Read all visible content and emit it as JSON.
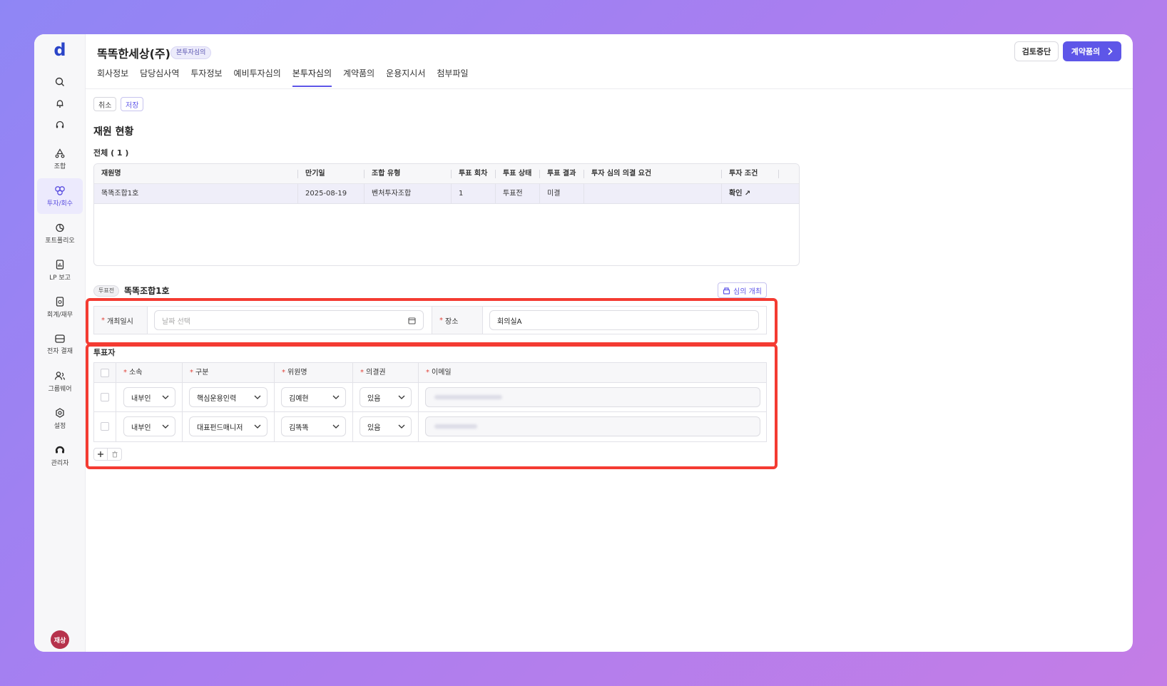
{
  "logo": "d",
  "sidebar": {
    "items": [
      {
        "label": "조합",
        "icon": "recycle-icon"
      },
      {
        "label": "투자/회수",
        "icon": "invest-icon",
        "active": true
      },
      {
        "label": "포트폴리오",
        "icon": "pie-chart-icon"
      },
      {
        "label": "LP 보고",
        "icon": "report-icon"
      },
      {
        "label": "회계/재무",
        "icon": "finance-doc-icon"
      },
      {
        "label": "전자 결재",
        "icon": "approval-icon"
      },
      {
        "label": "그룹웨어",
        "icon": "groupware-icon"
      },
      {
        "label": "설정",
        "icon": "settings-icon"
      },
      {
        "label": "관리자",
        "icon": "admin-icon"
      }
    ],
    "avatar": "재상"
  },
  "header": {
    "title": "똑똑한세상(주)",
    "badge": "본투자심의",
    "stop_label": "검토중단",
    "contract_label": "계약품의"
  },
  "tabs": [
    "회사정보",
    "담당심사역",
    "투자정보",
    "예비투자심의",
    "본투자심의",
    "계약품의",
    "운용지시서",
    "첨부파일"
  ],
  "active_tab": "본투자심의",
  "actions": {
    "cancel": "취소",
    "save": "저장"
  },
  "fund_section": {
    "title": "재원 현황",
    "total": "전체 ( 1 )",
    "columns": [
      "재원명",
      "만기일",
      "조합 유형",
      "투표 회차",
      "투표 상태",
      "투표 결과",
      "투자 심의 의결 요건",
      "투자 조건"
    ],
    "rows": [
      {
        "name": "똑똑조합1호",
        "due": "2025-08-19",
        "type": "벤처투자조합",
        "round": "1",
        "status": "투표전",
        "result": "미결",
        "requirement": "",
        "condition": "확인 ↗"
      }
    ]
  },
  "vote_section": {
    "badge": "투표전",
    "title": "똑똑조합1호",
    "open_button": "심의 개최",
    "date_label": "개최일시",
    "date_placeholder": "날짜 선택",
    "place_label": "장소",
    "place_value": "회의실A",
    "voters_label": "투표자",
    "voter_columns": [
      "소속",
      "구분",
      "위원명",
      "의결권",
      "이메일"
    ],
    "voters": [
      {
        "affiliation": "내부인",
        "category": "핵심운용인력",
        "name": "김예현",
        "vote_right": "있음"
      },
      {
        "affiliation": "내부인",
        "category": "대표펀드매니저",
        "name": "김똑똑",
        "vote_right": "있음"
      }
    ]
  },
  "colors": {
    "accent": "#5e56e8",
    "highlight_border": "#f43b32",
    "avatar": "#b6324c"
  }
}
